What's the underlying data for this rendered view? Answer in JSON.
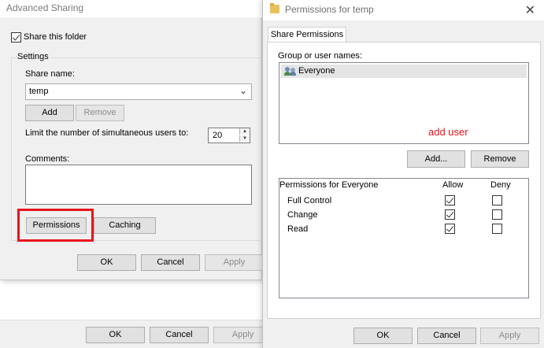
{
  "advanced_sharing": {
    "title": "Advanced Sharing",
    "share_this_folder_label": "Share this folder",
    "share_this_folder_checked": true,
    "settings_label": "Settings",
    "share_name_label": "Share name:",
    "share_name_value": "temp",
    "add_label": "Add",
    "remove_label": "Remove",
    "limit_users_label": "Limit the number of simultaneous users to:",
    "limit_users_value": "20",
    "comments_label": "Comments:",
    "comments_value": "",
    "permissions_label": "Permissions",
    "caching_label": "Caching",
    "ok_label": "OK",
    "cancel_label": "Cancel",
    "apply_label": "Apply"
  },
  "background_window": {
    "ok_label": "OK",
    "cancel_label": "Cancel",
    "apply_label": "Apply"
  },
  "permissions_window": {
    "title": "Permissions for temp",
    "close_glyph": "✕",
    "tab_label": "Share Permissions",
    "group_label": "Group or user names:",
    "users": [
      "Everyone"
    ],
    "annotation_text": "add user",
    "add_label": "Add...",
    "remove_label": "Remove",
    "permissions_header": "Permissions for Everyone",
    "allow_header": "Allow",
    "deny_header": "Deny",
    "permissions": [
      {
        "name": "Full Control",
        "allow": true,
        "deny": false
      },
      {
        "name": "Change",
        "allow": true,
        "deny": false
      },
      {
        "name": "Read",
        "allow": true,
        "deny": false
      }
    ],
    "ok_label": "OK",
    "cancel_label": "Cancel",
    "apply_label": "Apply"
  },
  "colors": {
    "highlight_box": "#e8141c",
    "annotation_text": "#e8141c",
    "dialog_bg": "#f0f0f0",
    "button_bg": "#e1e1e1"
  },
  "icons": {
    "folder": "folder-icon",
    "users": "users-icon",
    "close": "close-icon",
    "dropdown": "chevron-down-icon"
  }
}
